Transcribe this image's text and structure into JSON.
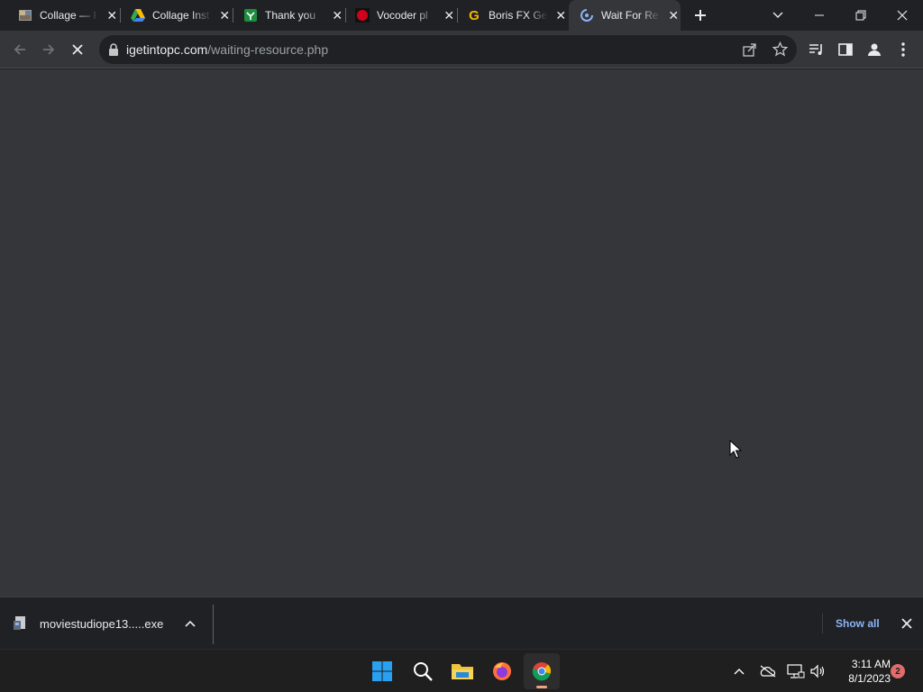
{
  "tabs": [
    {
      "title": "Collage — I",
      "icon": "collage-favicon"
    },
    {
      "title": "Collage Inst",
      "icon": "google-drive-favicon"
    },
    {
      "title": "Thank you",
      "icon": "sheets-favicon"
    },
    {
      "title": "Vocoder pl",
      "icon": "red-circle-favicon"
    },
    {
      "title": "Boris FX Ge",
      "icon": "google-g-favicon"
    },
    {
      "title": "Wait For Re",
      "icon": "loading-favicon"
    }
  ],
  "toolbar": {
    "url_domain": "igetintopc.com",
    "url_path": "/waiting-resource.php"
  },
  "download": {
    "filename": "moviestudiope13.....exe",
    "show_all": "Show all"
  },
  "taskbar": {
    "time": "3:11 AM",
    "date": "8/1/2023",
    "notifications": "2"
  },
  "colors": {
    "accent_blue": "#8ab4f8",
    "tab_active": "#35363a",
    "frame": "#202124"
  }
}
